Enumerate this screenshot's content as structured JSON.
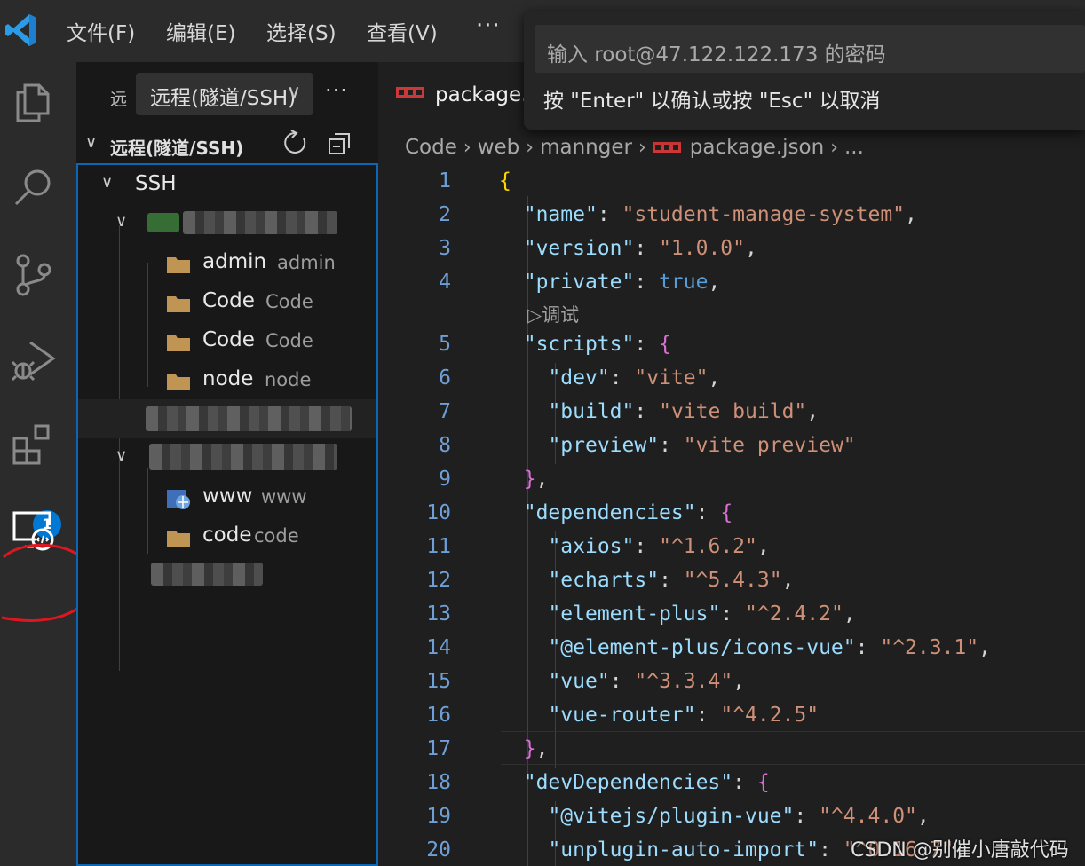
{
  "menu": {
    "items": [
      "文件(F)",
      "编辑(E)",
      "选择(S)",
      "查看(V)"
    ],
    "more": "···"
  },
  "activity_bar": {
    "icons": [
      "explorer-icon",
      "search-icon",
      "source-control-icon",
      "run-debug-icon",
      "extensions-icon",
      "remote-explorer-icon"
    ],
    "extensions_badge": "1"
  },
  "sidebar": {
    "header_abbrev": "远",
    "picker_value": "远程(隧道/SSH)",
    "more": "···",
    "section_title": "远程(隧道/SSH)",
    "ssh_label": "SSH",
    "folders_host1": [
      {
        "label": "admin",
        "desc": "admin"
      },
      {
        "label": "Code",
        "desc": "Code"
      },
      {
        "label": "Code",
        "desc": "Code"
      },
      {
        "label": "node",
        "desc": "node"
      }
    ],
    "folders_host2": [
      {
        "label": "www",
        "desc": "www"
      },
      {
        "label": "code",
        "desc": "code"
      }
    ]
  },
  "editor": {
    "tab_label": "package.json",
    "breadcrumb": [
      "Code",
      "web",
      "mannger",
      "package.json",
      "..."
    ],
    "codelens": "▷调试",
    "lines": [
      {
        "n": "1",
        "t": "{"
      },
      {
        "n": "2",
        "t": "  \"name\": \"student-manage-system\","
      },
      {
        "n": "3",
        "t": "  \"version\": \"1.0.0\","
      },
      {
        "n": "4",
        "t": "  \"private\": true,"
      },
      {
        "n": "5",
        "t": "  \"scripts\": {"
      },
      {
        "n": "6",
        "t": "    \"dev\": \"vite\","
      },
      {
        "n": "7",
        "t": "    \"build\": \"vite build\","
      },
      {
        "n": "8",
        "t": "    \"preview\": \"vite preview\""
      },
      {
        "n": "9",
        "t": "  },"
      },
      {
        "n": "10",
        "t": "  \"dependencies\": {"
      },
      {
        "n": "11",
        "t": "    \"axios\": \"^1.6.2\","
      },
      {
        "n": "12",
        "t": "    \"echarts\": \"^5.4.3\","
      },
      {
        "n": "13",
        "t": "    \"element-plus\": \"^2.4.2\","
      },
      {
        "n": "14",
        "t": "    \"@element-plus/icons-vue\": \"^2.3.1\","
      },
      {
        "n": "15",
        "t": "    \"vue\": \"^3.3.4\","
      },
      {
        "n": "16",
        "t": "    \"vue-router\": \"^4.2.5\""
      },
      {
        "n": "17",
        "t": "  },"
      },
      {
        "n": "18",
        "t": "  \"devDependencies\": {"
      },
      {
        "n": "19",
        "t": "    \"@vitejs/plugin-vue\": \"^4.4.0\","
      },
      {
        "n": "20",
        "t": "    \"unplugin-auto-import\": \"^0.16.7\","
      }
    ]
  },
  "quick_input": {
    "placeholder": "输入 root@47.122.122.173 的密码",
    "message": "按 \"Enter\" 以确认或按 \"Esc\" 以取消"
  },
  "watermark": "CSDN @别催小唐敲代码",
  "colors": {
    "accent": "#0078d4",
    "annotation": "#e0161e",
    "folder": "#c09553"
  }
}
